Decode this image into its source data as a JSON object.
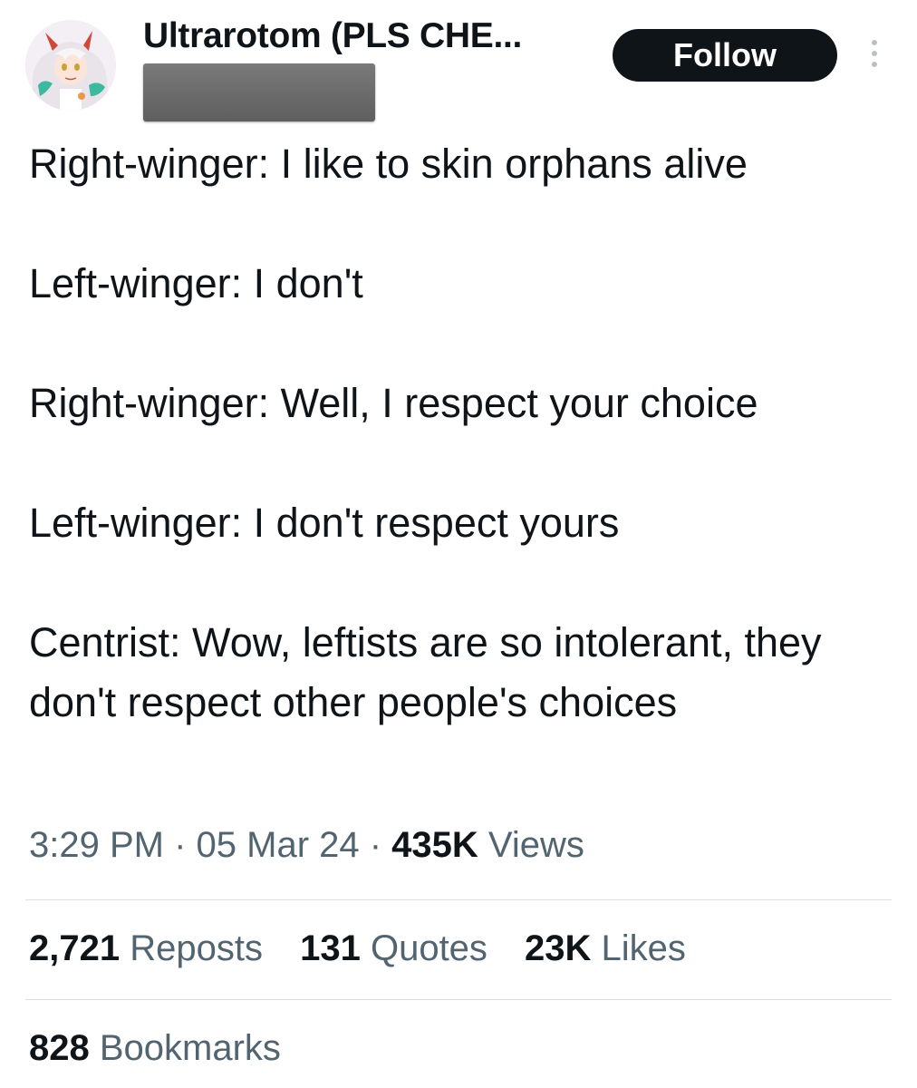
{
  "author": {
    "display_name": "Ultrarotom (PLS CHE...",
    "avatar_icon": "anime-character-avatar-icon"
  },
  "header": {
    "follow_label": "Follow",
    "more_icon": "more-options-vertical-icon"
  },
  "tweet": {
    "lines": [
      "Right-winger: I like to skin orphans alive",
      "Left-winger: I don't",
      "Right-winger: Well, I respect your choice",
      "Left-winger: I don't respect yours",
      "Centrist: Wow, leftists are so intolerant, they don't respect other people's choices"
    ]
  },
  "meta": {
    "time": "3:29 PM",
    "separator": " · ",
    "date": "05 Mar 24",
    "views_count": "435K",
    "views_label": " Views"
  },
  "stats": {
    "reposts_count": "2,721",
    "reposts_label": " Reposts",
    "quotes_count": "131",
    "quotes_label": " Quotes",
    "likes_count": "23K",
    "likes_label": " Likes",
    "bookmarks_count": "828",
    "bookmarks_label": " Bookmarks"
  },
  "colors": {
    "text_primary": "#0f1419",
    "text_secondary": "#536471",
    "follow_bg": "#0f1419",
    "follow_text": "#ffffff",
    "divider": "#dcdfe2",
    "redaction": "#6b6b6b"
  }
}
